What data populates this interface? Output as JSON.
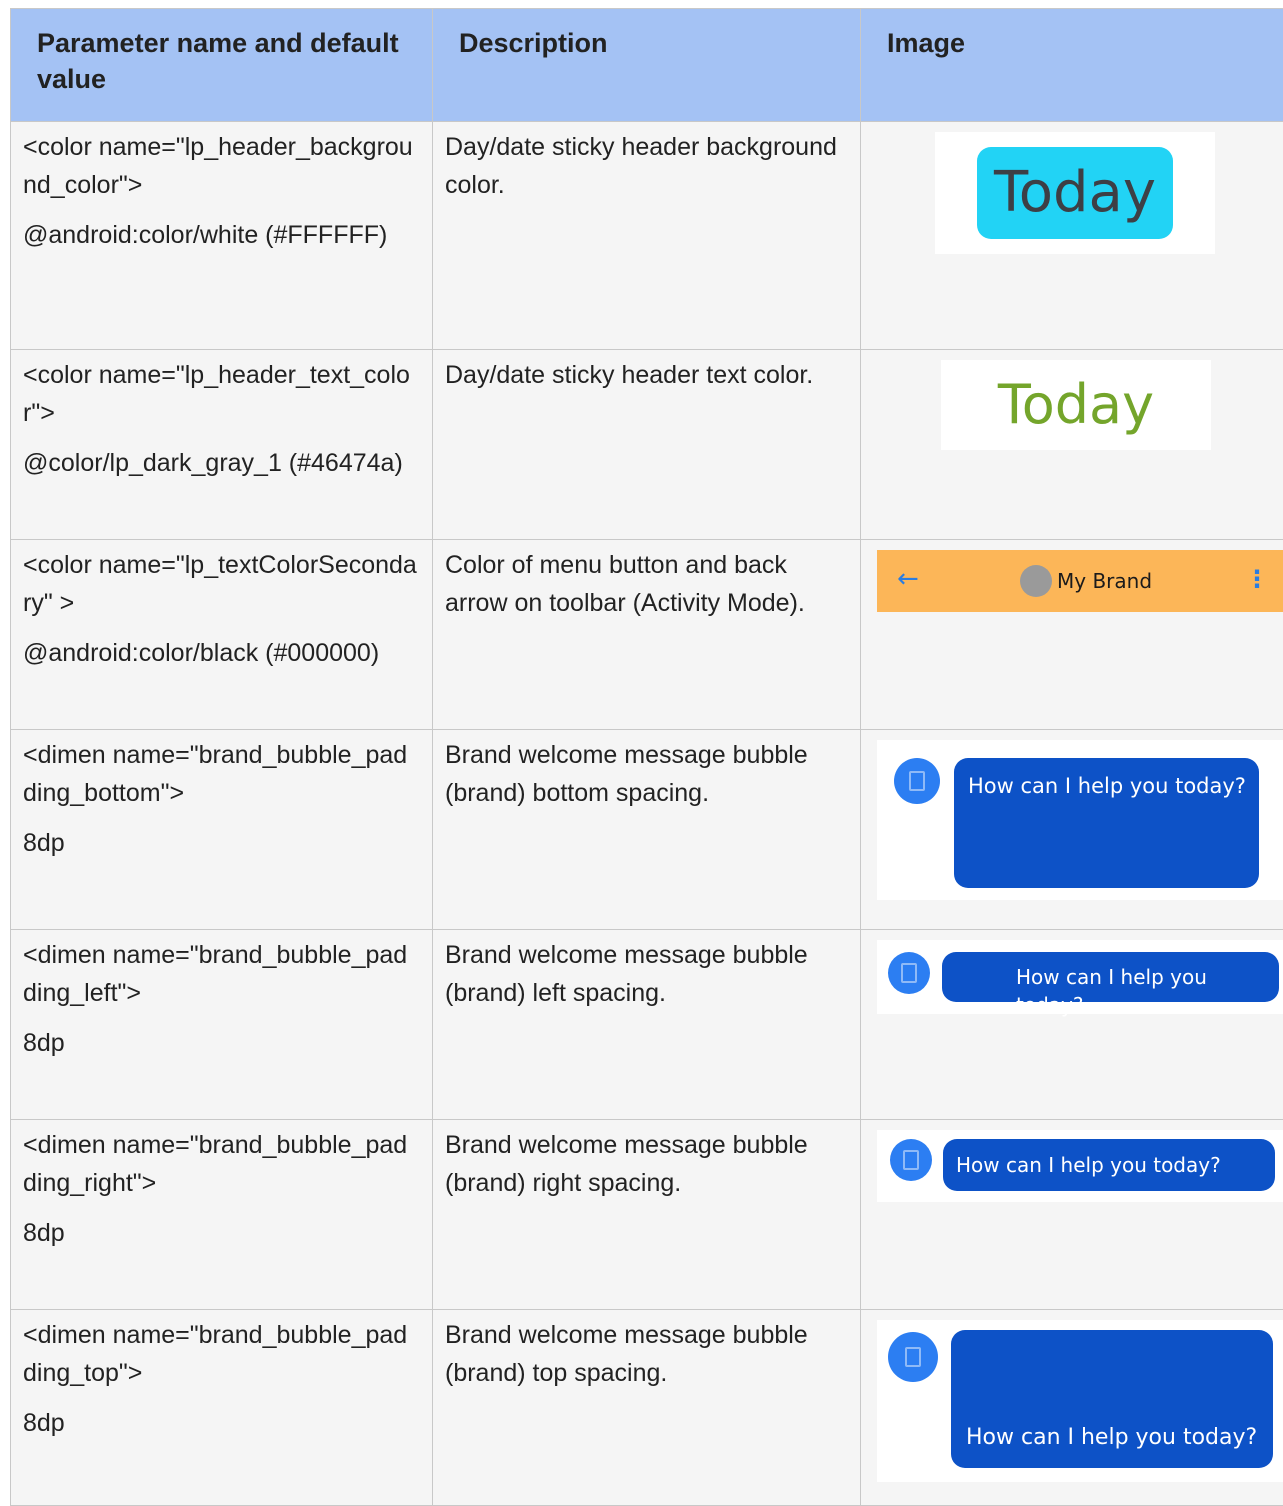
{
  "headers": {
    "param": "Parameter name and default value",
    "description": "Description",
    "image": "Image"
  },
  "rows": [
    {
      "name": "<color name=\"lp_header_background_color\">",
      "value": "@android:color/white (#FFFFFF)",
      "description": "Day/date sticky header background color.",
      "image_text": "Today"
    },
    {
      "name": "<color name=\"lp_header_text_color\">",
      "value": "@color/lp_dark_gray_1 (#46474a)",
      "description": "Day/date sticky header text color.",
      "image_text": "Today"
    },
    {
      "name": "<color name=\"lp_textColorSecondary\" >",
      "value": "@android:color/black (#000000)",
      "description": "Color of menu button and back arrow on toolbar (Activity Mode).",
      "image_text": "My Brand"
    },
    {
      "name": "<dimen name=\"brand_bubble_padding_bottom\">",
      "value": "8dp",
      "description": "Brand welcome message bubble (brand) bottom spacing.",
      "image_text": "How can I help you today?"
    },
    {
      "name": "<dimen name=\"brand_bubble_padding_left\">",
      "value": "8dp",
      "description": "Brand welcome message bubble (brand) left spacing.",
      "image_text": "How can I help you today?"
    },
    {
      "name": "<dimen name=\"brand_bubble_padding_right\">",
      "value": "8dp",
      "description": "Brand welcome message bubble (brand) right spacing.",
      "image_text": "How can I help you today?"
    },
    {
      "name": "<dimen name=\"brand_bubble_padding_top\">",
      "value": "8dp",
      "description": "Brand welcome message bubble (brand) top spacing.",
      "image_text": "How can I help you today?"
    }
  ],
  "icons": {
    "back": "back-arrow-icon",
    "menu": "overflow-menu-icon",
    "brand": "building-icon"
  },
  "colors": {
    "header_bg": "#a4c2f4",
    "cell_bg": "#f5f5f5",
    "today_pill": "#22d3f5",
    "today_green": "#74a52b",
    "toolbar": "#fcb658",
    "bubble": "#0d52c7",
    "icon": "#2c7ef2"
  }
}
